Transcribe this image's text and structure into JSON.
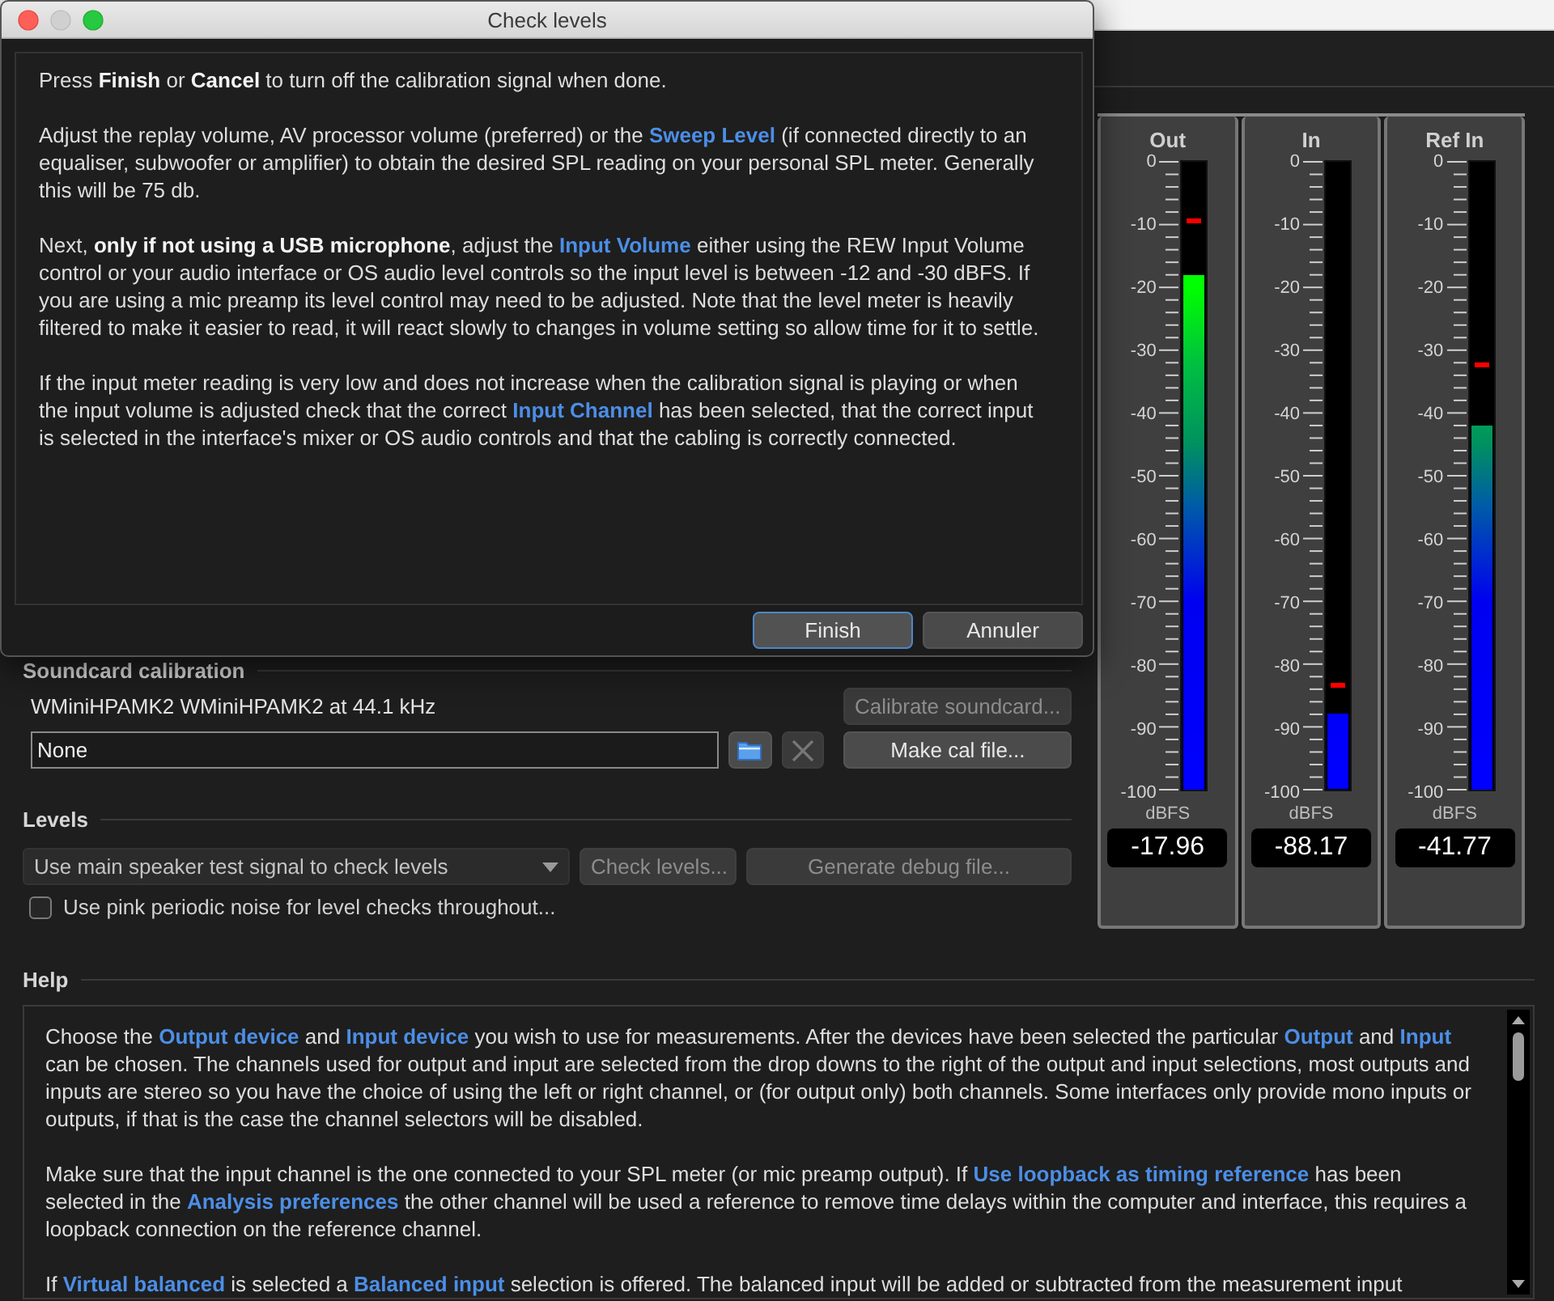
{
  "dialog": {
    "title": "Check levels",
    "paragraphs": [
      [
        {
          "kind": "plain",
          "text": "Press "
        },
        {
          "kind": "bold",
          "text": "Finish"
        },
        {
          "kind": "plain",
          "text": " or "
        },
        {
          "kind": "bold",
          "text": "Cancel"
        },
        {
          "kind": "plain",
          "text": " to turn off the calibration signal when done."
        }
      ],
      [
        {
          "kind": "plain",
          "text": "Adjust the replay volume, AV processor volume (preferred) or the "
        },
        {
          "kind": "link",
          "text": "Sweep Level"
        },
        {
          "kind": "plain",
          "text": " (if connected directly to an equaliser, subwoofer or amplifier) to obtain the desired SPL reading on your personal SPL meter. Generally this will be 75 db."
        }
      ],
      [
        {
          "kind": "plain",
          "text": "Next, "
        },
        {
          "kind": "bold",
          "text": "only if not using a USB microphone"
        },
        {
          "kind": "plain",
          "text": ", adjust the "
        },
        {
          "kind": "link",
          "text": "Input Volume"
        },
        {
          "kind": "plain",
          "text": " either using the REW Input Volume control or your audio interface or OS audio level controls so the input level is between -12 and -30 dBFS. If you are using a mic preamp its level control may need to be adjusted. Note that the level meter is heavily filtered to make it easier to read, it will react slowly to changes in volume setting so allow time for it to settle."
        }
      ],
      [
        {
          "kind": "plain",
          "text": "If the input meter reading is very low and does not increase when the calibration signal is playing or when the input volume is adjusted check that the correct "
        },
        {
          "kind": "link",
          "text": "Input Channel"
        },
        {
          "kind": "plain",
          "text": " has been selected, that the correct input is selected in the interface's mixer or OS audio controls and that the cabling is correctly connected."
        }
      ]
    ],
    "buttons": [
      {
        "label": "Finish",
        "default": true
      },
      {
        "label": "Annuler",
        "default": false
      }
    ]
  },
  "soundcard_calibration": {
    "heading": "Soundcard calibration",
    "device": "WMiniHPAMK2 WMiniHPAMK2 at 44.1 kHz",
    "calibrate_button": {
      "label": "Calibrate soundcard...",
      "disabled": true
    },
    "cal_file": {
      "value": "None"
    },
    "clear_button": {
      "disabled": true
    },
    "make_cal_button": {
      "label": "Make cal file...",
      "disabled": false
    }
  },
  "levels": {
    "heading": "Levels",
    "signal_select": {
      "value": "Use main speaker test signal to check levels"
    },
    "check_button": {
      "label": "Check levels...",
      "disabled": true
    },
    "debug_button": {
      "label": "Generate debug file...",
      "disabled": true
    },
    "pink_noise": {
      "label": "Use pink periodic noise for level checks throughout...",
      "checked": false
    }
  },
  "meters": [
    {
      "name": "Out",
      "scale": [
        "0",
        "-10",
        "-20",
        "-30",
        "-40",
        "-50",
        "-60",
        "-70",
        "-80",
        "-90",
        "-100"
      ],
      "level": 0.82,
      "peak": {
        "level": 0.905
      },
      "unit": "dBFS",
      "reading": "-17.96"
    },
    {
      "name": "In",
      "scale": [
        "0",
        "-10",
        "-20",
        "-30",
        "-40",
        "-50",
        "-60",
        "-70",
        "-80",
        "-90",
        "-100"
      ],
      "level": 0.12,
      "peak": {
        "level": 0.165
      },
      "unit": "dBFS",
      "reading": "-88.17"
    },
    {
      "name": "Ref In",
      "scale": [
        "0",
        "-10",
        "-20",
        "-30",
        "-40",
        "-50",
        "-60",
        "-70",
        "-80",
        "-90",
        "-100"
      ],
      "level": 0.58,
      "peak": {
        "level": 0.675
      },
      "unit": "dBFS",
      "reading": "-41.77"
    }
  ],
  "help": {
    "heading": "Help",
    "paragraphs": [
      [
        {
          "kind": "plain",
          "text": "Choose the "
        },
        {
          "kind": "link",
          "text": "Output device"
        },
        {
          "kind": "plain",
          "text": " and "
        },
        {
          "kind": "link",
          "text": "Input device"
        },
        {
          "kind": "plain",
          "text": " you wish to use for measurements. After the devices have been selected the particular "
        },
        {
          "kind": "link",
          "text": "Output"
        },
        {
          "kind": "plain",
          "text": " and "
        },
        {
          "kind": "link",
          "text": "Input"
        },
        {
          "kind": "plain",
          "text": " can be chosen. The channels used for output and input are selected from the drop downs to the right of the output and input selections, most outputs and inputs are stereo so you have the choice of using the left or right channel, or (for output only) both channels. Some interfaces only provide mono inputs or outputs, if that is the case the channel selectors will be disabled."
        }
      ],
      [
        {
          "kind": "plain",
          "text": "Make sure that the input channel is the one connected to your SPL meter (or mic preamp output). If "
        },
        {
          "kind": "link",
          "text": "Use loopback as timing reference"
        },
        {
          "kind": "plain",
          "text": " has been selected in the "
        },
        {
          "kind": "link",
          "text": "Analysis preferences"
        },
        {
          "kind": "plain",
          "text": " the other channel will be used a reference to remove time delays within the computer and interface, this requires a loopback connection on the reference channel."
        }
      ],
      [
        {
          "kind": "plain",
          "text": "If "
        },
        {
          "kind": "link",
          "text": "Virtual balanced"
        },
        {
          "kind": "plain",
          "text": " is selected a "
        },
        {
          "kind": "link",
          "text": "Balanced input"
        },
        {
          "kind": "plain",
          "text": " selection is offered. The balanced input will be added or subtracted from the measurement input"
        }
      ]
    ]
  }
}
